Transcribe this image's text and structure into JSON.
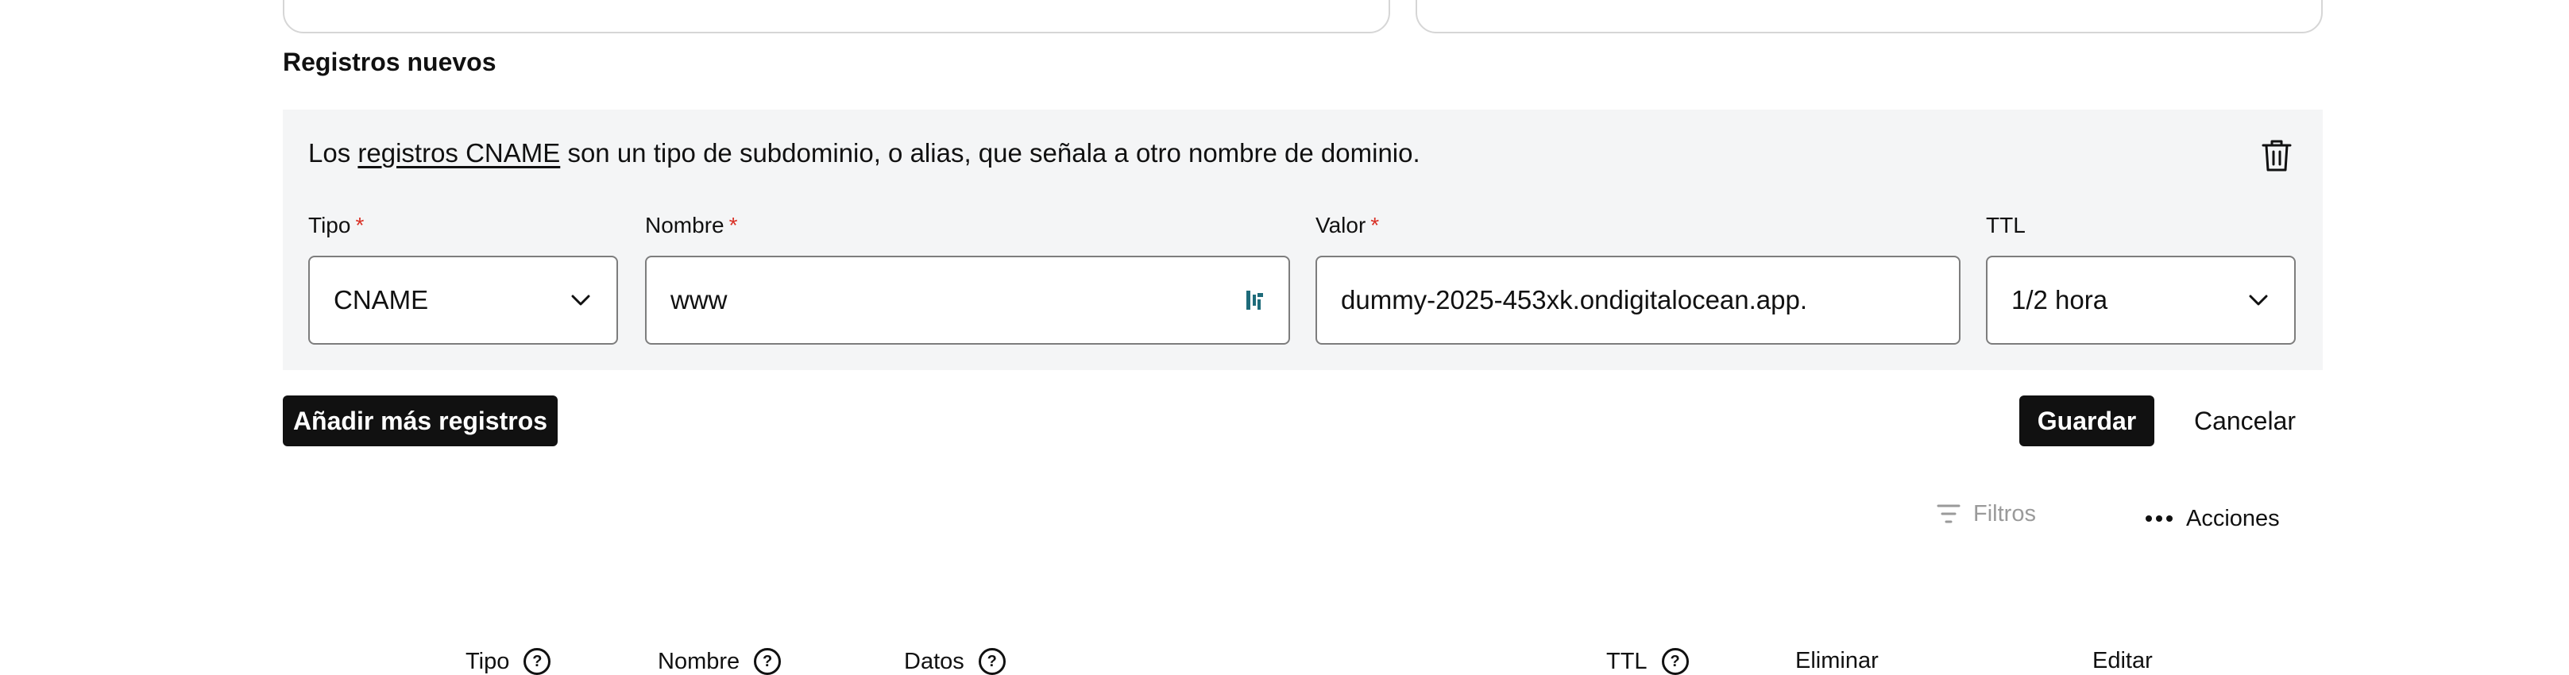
{
  "section": {
    "title": "Registros nuevos"
  },
  "info": {
    "prefix": "Los",
    "link": "registros CNAME",
    "suffix": "son un tipo de subdominio, o alias, que señala a otro nombre de dominio."
  },
  "form": {
    "required_mark": "*",
    "tipo": {
      "label": "Tipo",
      "value": "CNAME"
    },
    "nombre": {
      "label": "Nombre",
      "value": "www"
    },
    "valor": {
      "label": "Valor",
      "value": "dummy-2025-453xk.ondigitalocean.app."
    },
    "ttl": {
      "label": "TTL",
      "value": "1/2 hora"
    }
  },
  "actions": {
    "add_more": "Añadir más registros",
    "save": "Guardar",
    "cancel": "Cancelar"
  },
  "toolbar": {
    "filters": "Filtros",
    "actions": "Acciones"
  },
  "table": {
    "headers": [
      "Tipo",
      "Nombre",
      "Datos",
      "TTL",
      "Eliminar",
      "Editar"
    ],
    "help_glyph": "?"
  },
  "colors": {
    "required": "#d93025",
    "dark_button": "#111111",
    "panel_bg": "#f4f5f6"
  },
  "icons": [
    "trash-icon",
    "chevron-down-icon",
    "password-manager-icon",
    "filter-icon",
    "more-horizontal-icon",
    "help-circle-icon"
  ]
}
